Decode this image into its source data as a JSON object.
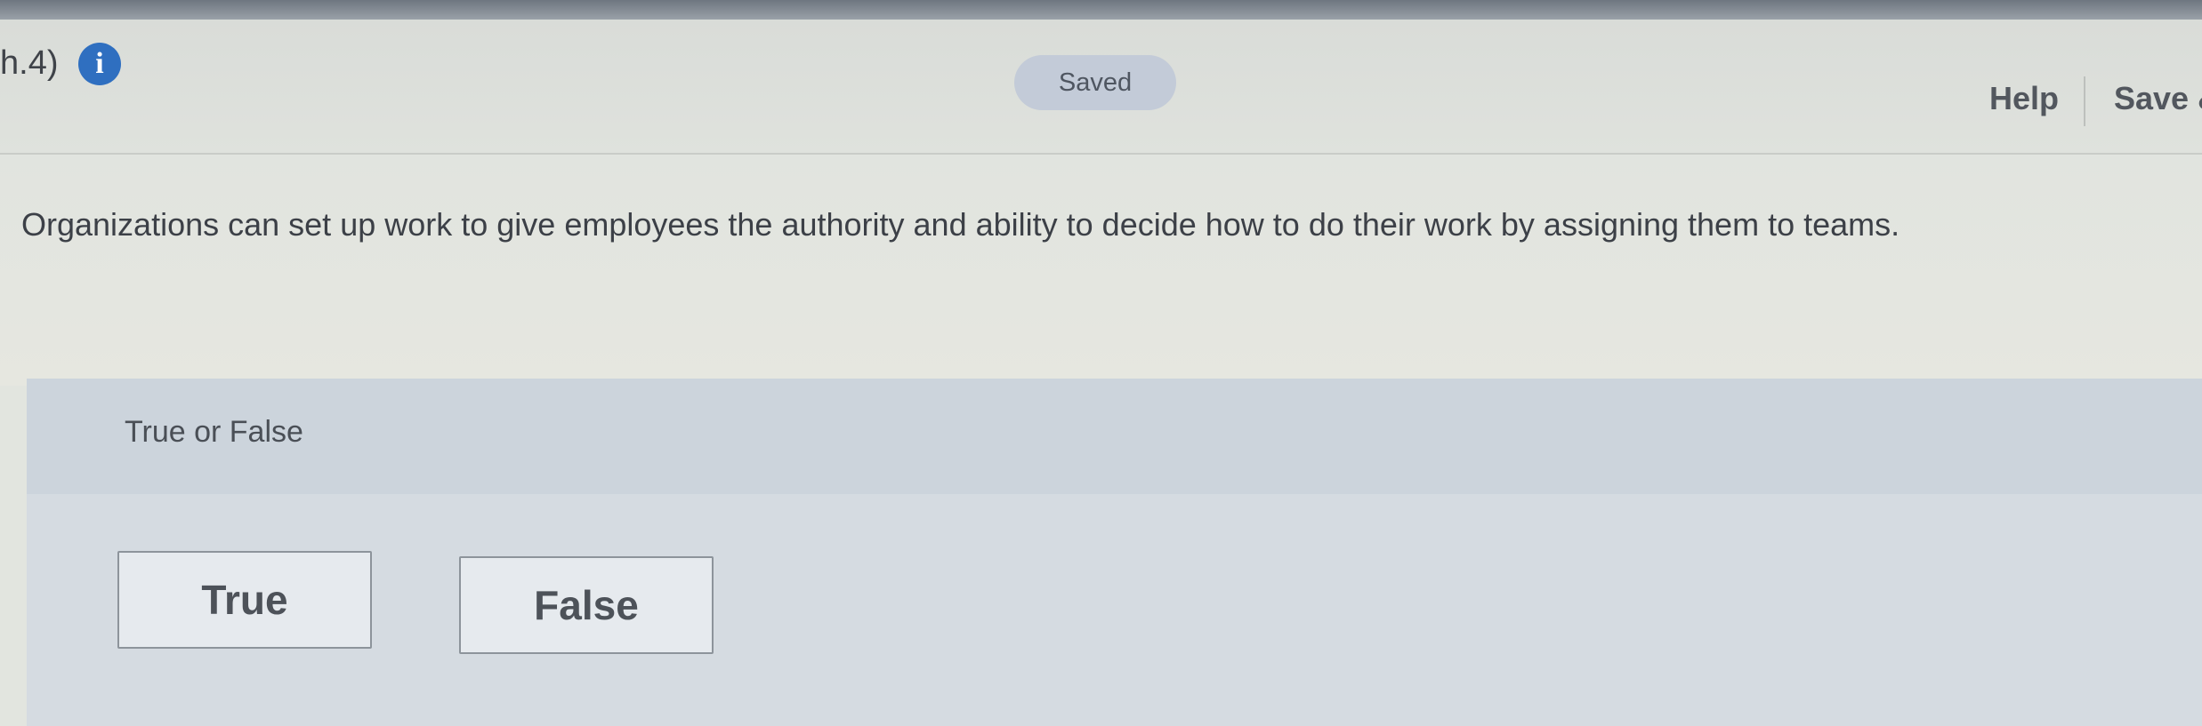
{
  "header": {
    "question_number": "h.4)",
    "info_icon": "info-icon",
    "status": "Saved",
    "help_label": "Help",
    "save_label": "Save &"
  },
  "question": {
    "text": "Organizations can set up work to give employees the authority and ability to decide how to do their work by assigning them to teams.",
    "prompt": "True or False"
  },
  "choices": {
    "true_label": "True",
    "false_label": "False"
  },
  "colors": {
    "info_icon": "#2f6fc0",
    "saved_pill": "#c3cbd8",
    "answer_panel": "#d5dbe1"
  }
}
